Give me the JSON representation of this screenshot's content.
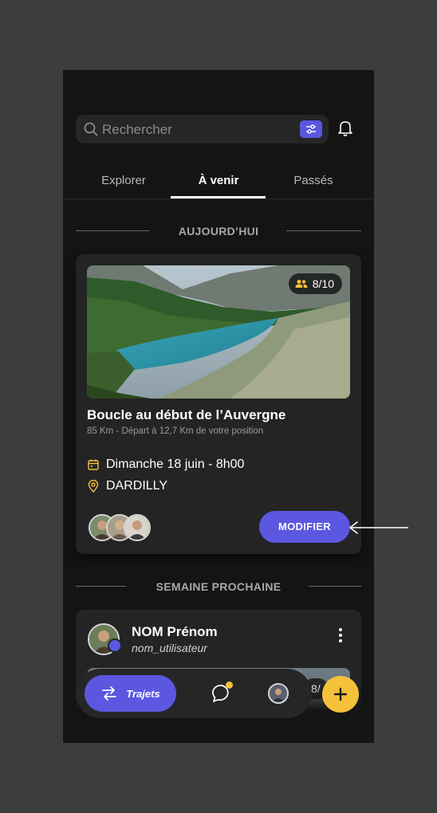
{
  "search": {
    "placeholder": "Rechercher"
  },
  "tabs": [
    {
      "label": "Explorer"
    },
    {
      "label": "À venir"
    },
    {
      "label": "Passés"
    }
  ],
  "sections": {
    "today": "AUJOURD’HUI",
    "next_week": "SEMAINE PROCHAINE"
  },
  "trip_card": {
    "participants": "8/10",
    "title": "Boucle au début de l’Auvergne",
    "subtitle": "85 Km - Départ à 12,7 Km de votre position",
    "date": "Dimanche 18 juin - 8h00",
    "location": "DARDILLY",
    "action_label": "MODIFIER"
  },
  "user_card": {
    "name": "NOM Prénom",
    "username": "nom_utilisateur",
    "participants": "8/"
  },
  "nav": {
    "active_label": "Trajets"
  },
  "colors": {
    "accent": "#5b57e0",
    "highlight": "#f5c13a",
    "background": "#141414",
    "card": "#242424"
  },
  "icons": [
    "search-icon",
    "filter-icon",
    "bell-icon",
    "people-icon",
    "calendar-icon",
    "location-pin-icon",
    "more-vertical-icon",
    "swap-route-icon",
    "chat-bubble-icon",
    "plus-icon",
    "arrow-left-icon"
  ]
}
